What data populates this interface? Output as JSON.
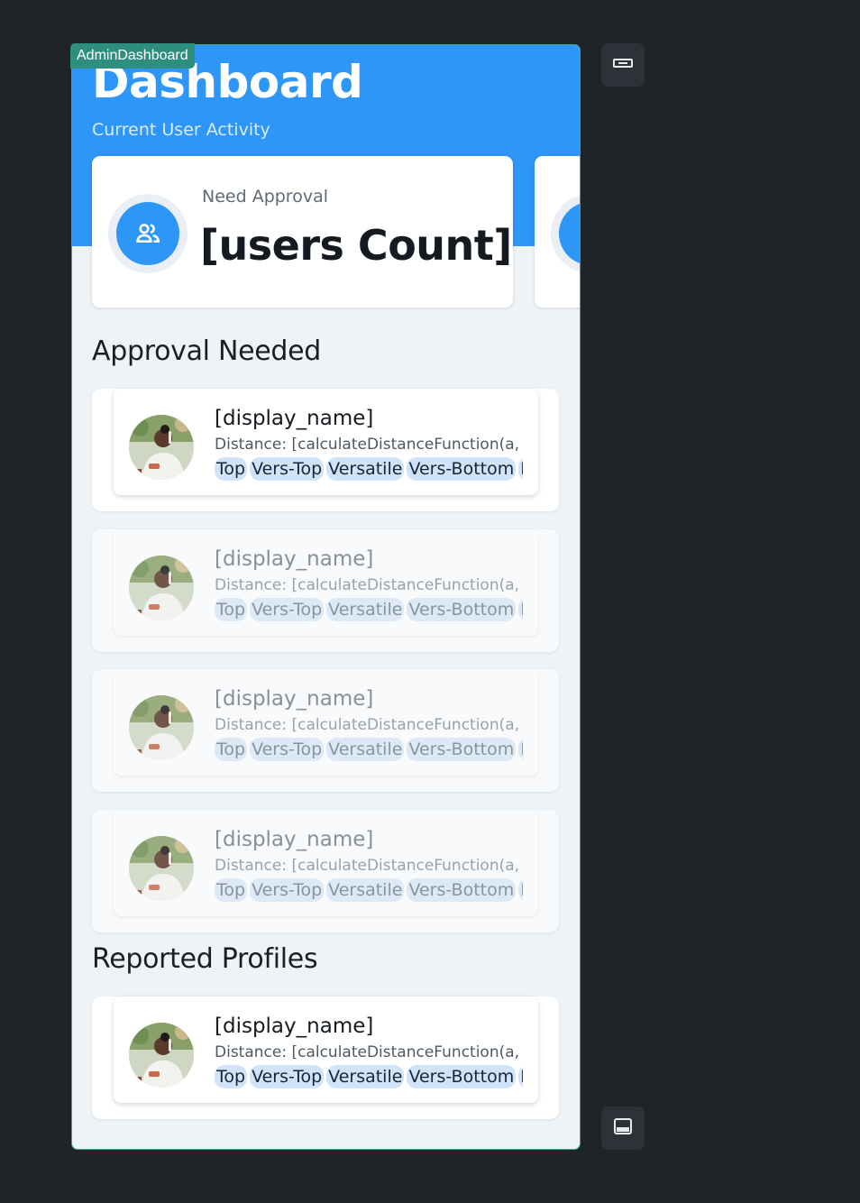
{
  "frame": {
    "tag": "AdminDashboard"
  },
  "header": {
    "title": "Dashboard",
    "subtitle": "Current User Activity"
  },
  "stats": [
    {
      "label": "Need Approval",
      "value": "[users Count]",
      "icon": "users-icon"
    },
    {
      "label": "",
      "value": "",
      "icon": "stat-icon"
    }
  ],
  "sections": {
    "approval": {
      "title": "Approval Needed"
    },
    "reported": {
      "title": "Reported Profiles"
    }
  },
  "approval_items": [
    {
      "name": "[display_name]",
      "distance": "Distance:  [calculateDistanceFunction(a, b)]",
      "chips": [
        "Top",
        "Vers-Top",
        "Versatile",
        "Vers-Bottom",
        "Bottom"
      ]
    },
    {
      "name": "[display_name]",
      "distance": "Distance:  [calculateDistanceFunction(a, b)]",
      "chips": [
        "Top",
        "Vers-Top",
        "Versatile",
        "Vers-Bottom",
        "Bottom"
      ]
    },
    {
      "name": "[display_name]",
      "distance": "Distance:  [calculateDistanceFunction(a, b)]",
      "chips": [
        "Top",
        "Vers-Top",
        "Versatile",
        "Vers-Bottom",
        "Bottom"
      ]
    },
    {
      "name": "[display_name]",
      "distance": "Distance:  [calculateDistanceFunction(a, b)]",
      "chips": [
        "Top",
        "Vers-Top",
        "Versatile",
        "Vers-Bottom",
        "Bottom"
      ]
    }
  ],
  "reported_items": [
    {
      "name": "[display_name]",
      "distance": "Distance:  [calculateDistanceFunction(a, b)]",
      "chips": [
        "Top",
        "Vers-Top",
        "Versatile",
        "Vers-Bottom",
        "Bottom"
      ]
    }
  ],
  "side_buttons": [
    "collapse-icon",
    "panel-bottom-icon"
  ]
}
